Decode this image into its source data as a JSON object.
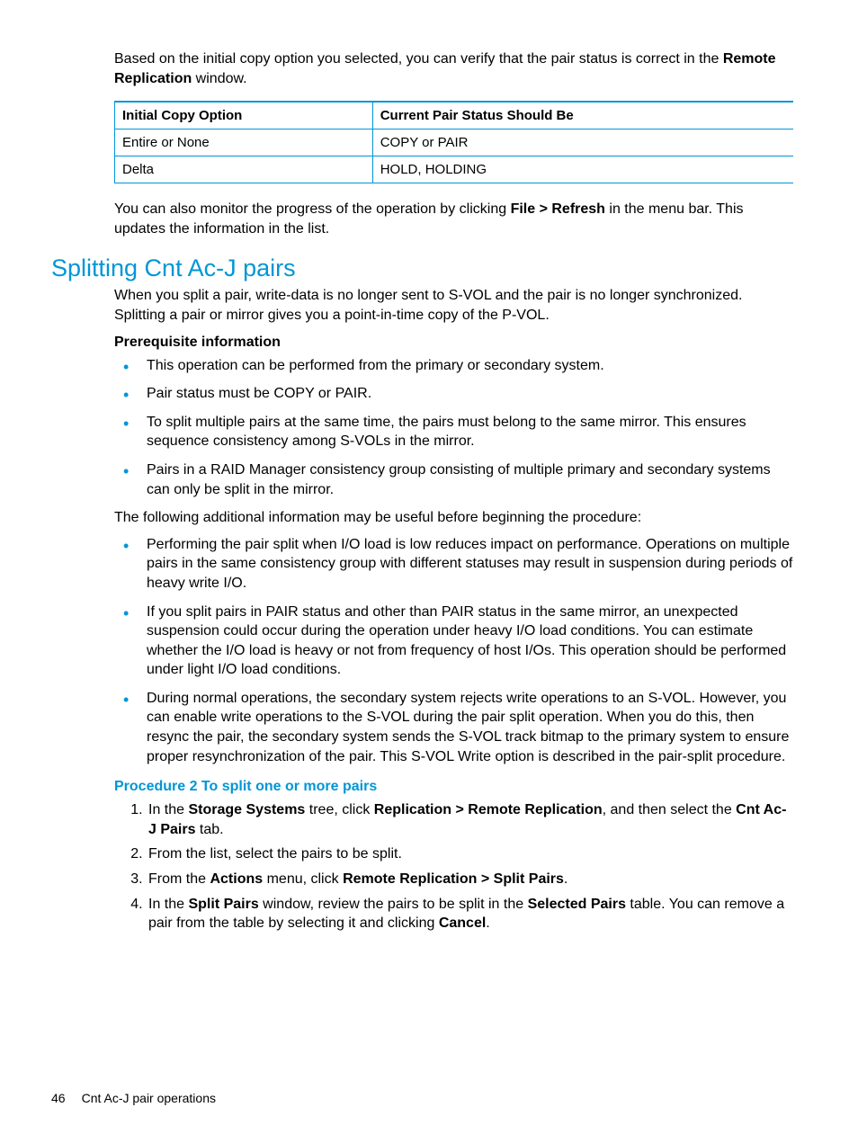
{
  "intro": {
    "p1_a": "Based on the initial copy option you selected, you can verify that the pair status is correct in the ",
    "p1_bold": "Remote Replication",
    "p1_b": " window."
  },
  "table": {
    "h1": "Initial Copy Option",
    "h2": "Current Pair Status Should Be",
    "rows": [
      {
        "c1": "Entire or None",
        "c2": "COPY or PAIR"
      },
      {
        "c1": "Delta",
        "c2": "HOLD, HOLDING"
      }
    ]
  },
  "intro2": {
    "a": "You can also monitor the progress of the operation by clicking ",
    "bold": "File > Refresh",
    "b": " in the menu bar. This updates the information in the list."
  },
  "heading": "Splitting Cnt Ac-J pairs",
  "split_intro": "When you split a pair, write-data is no longer sent to S-VOL and the pair is no longer synchronized. Splitting a pair or mirror gives you a point-in-time copy of the P-VOL.",
  "prereq_heading": "Prerequisite information",
  "prereq_bullets": [
    "This operation can be performed from the primary or secondary system.",
    "Pair status must be COPY or PAIR.",
    "To split multiple pairs at the same time, the pairs must belong to the same mirror. This ensures sequence consistency among S-VOLs in the mirror.",
    "Pairs in a RAID Manager consistency group consisting of multiple primary and secondary systems can only be split in the mirror."
  ],
  "additional_intro": "The following additional information may be useful before beginning the procedure:",
  "additional_bullets": [
    "Performing the pair split when I/O load is low reduces impact on performance. Operations on multiple pairs in the same consistency group with different statuses may result in suspension during periods of heavy write I/O.",
    "If you split pairs in PAIR status and other than PAIR status in the same mirror, an unexpected suspension could occur during the operation under heavy I/O load conditions. You can estimate whether the I/O load is heavy or not from frequency of host I/Os. This operation should be performed under light I/O load conditions.",
    "During normal operations, the secondary system rejects write operations to an S-VOL. However, you can enable write operations to the S-VOL during the pair split operation. When you do this, then resync the pair, the secondary system sends the S-VOL track bitmap to the primary system to ensure proper resynchronization of the pair. This S-VOL Write option is described in the pair-split procedure."
  ],
  "procedure_heading": "Procedure 2 To split one or more pairs",
  "steps": {
    "s1": {
      "a": "In the ",
      "b1": "Storage Systems",
      "c": " tree, click ",
      "b2": "Replication > Remote Replication",
      "d": ", and then select the ",
      "b3": "Cnt Ac-J Pairs",
      "e": " tab."
    },
    "s2": "From the list, select the pairs to be split.",
    "s3": {
      "a": "From the ",
      "b1": "Actions",
      "c": " menu, click ",
      "b2": "Remote Replication > Split Pairs",
      "d": "."
    },
    "s4": {
      "a": "In the ",
      "b1": "Split Pairs",
      "c": " window, review the pairs to be split in the ",
      "b2": "Selected Pairs",
      "d": " table. You can remove a pair from the table by selecting it and clicking ",
      "b3": "Cancel",
      "e": "."
    }
  },
  "footer": {
    "page": "46",
    "section": "Cnt Ac-J pair operations"
  }
}
